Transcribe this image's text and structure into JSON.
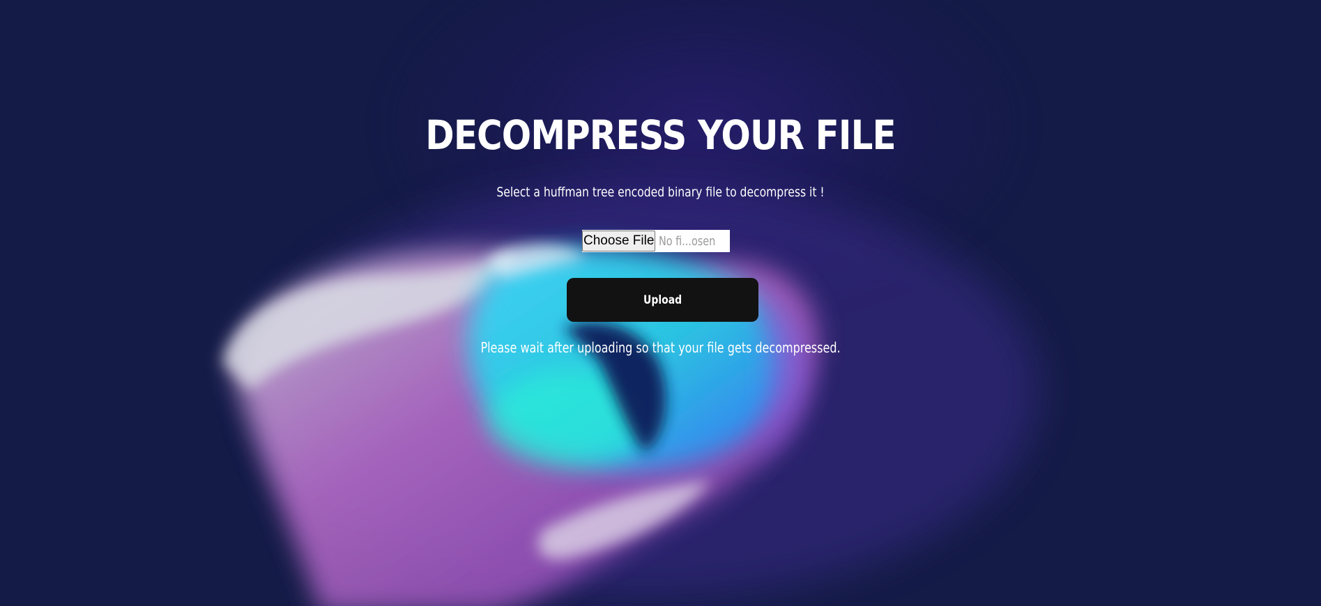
{
  "page": {
    "title": "DECOMPRESS YOUR FILE",
    "subtitle": "Select a huffman tree encoded binary file to decompress it !",
    "file_input": {
      "button_label": "Choose File",
      "status": "No fi...osen"
    },
    "upload_label": "Upload",
    "note": "Please wait after uploading so that your file gets decompressed."
  },
  "colors": {
    "background": "#141b47",
    "button": "#121212",
    "text": "#ffffff"
  }
}
